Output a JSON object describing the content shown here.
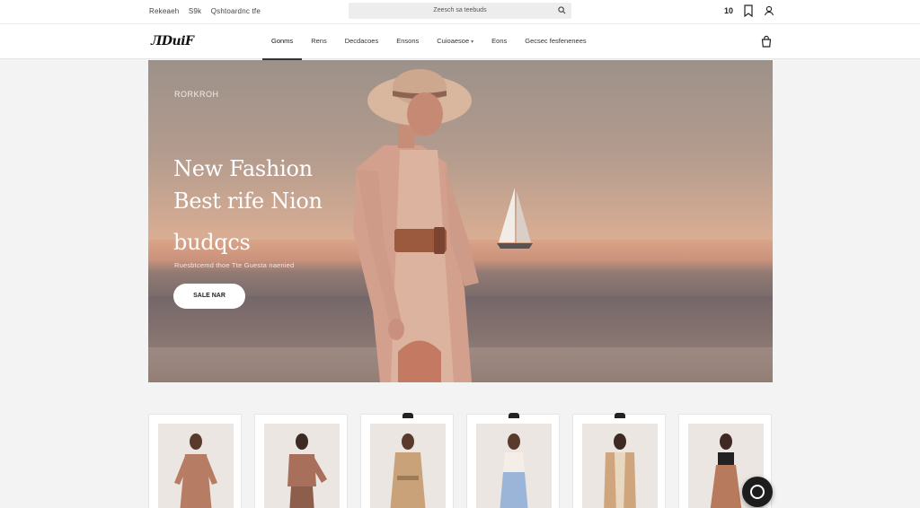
{
  "topbar": {
    "promo": [
      "Rekeaeh",
      "S9k",
      "Qshtoardnc tfe"
    ],
    "search_placeholder": "Zeesch sa teebuds",
    "cart_count": "10"
  },
  "brand": {
    "logo": "ЛDuiF"
  },
  "nav": {
    "items": [
      {
        "label": "Gonms",
        "active": true
      },
      {
        "label": "Rens",
        "active": false
      },
      {
        "label": "Decdacoes",
        "active": false
      },
      {
        "label": "Ensons",
        "active": false
      },
      {
        "label": "Cuioaesoe",
        "active": false
      },
      {
        "label": "Eons",
        "active": false
      },
      {
        "label": "Gecsec fesfenenees",
        "active": false
      }
    ]
  },
  "hero": {
    "eyebrow": "RORKROH",
    "headline": [
      "New Fashion",
      "Best rife Nion",
      "budqcs"
    ],
    "subtitle": "Ruesbtcemd thoe Tte Guesta naenied",
    "cta": "SALE NAR"
  },
  "products": [
    {
      "name": "product-1",
      "color": "#b67d64"
    },
    {
      "name": "product-2",
      "color": "#a8705b"
    },
    {
      "name": "product-3",
      "color": "#c9a27a"
    },
    {
      "name": "product-4",
      "color": "#9ab5d8"
    },
    {
      "name": "product-5",
      "color": "#cfa57d"
    },
    {
      "name": "product-6",
      "color": "#b87a5d"
    }
  ],
  "colors": {
    "accent": "#222222",
    "hero_sky": "#d9ad93"
  },
  "icons": {
    "search": "search-icon",
    "wishlist": "heart-icon",
    "account": "user-icon",
    "bag": "shopping-bag-icon",
    "chat": "chat-icon"
  }
}
